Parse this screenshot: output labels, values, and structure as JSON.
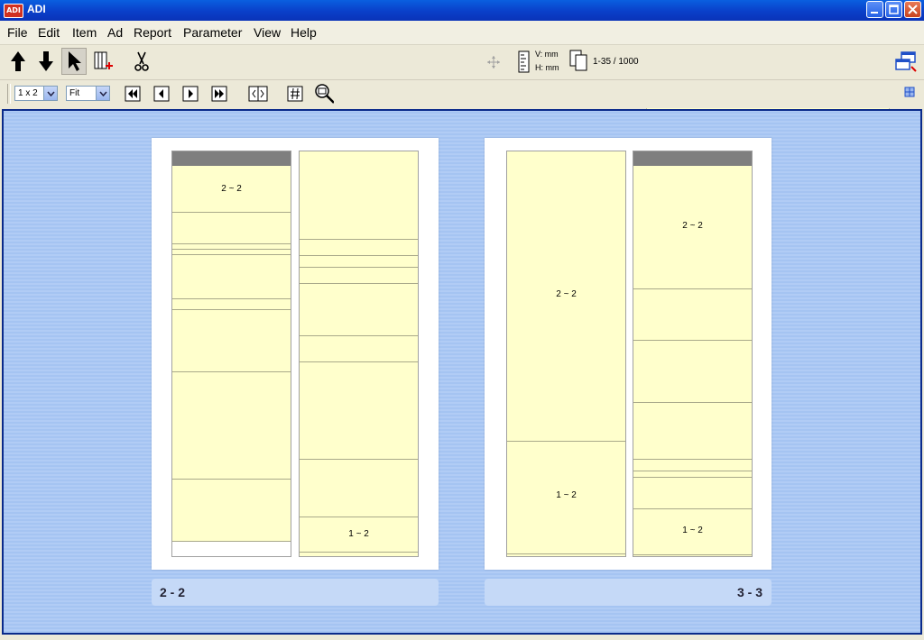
{
  "window": {
    "title": "ADI",
    "icon_label": "ADI"
  },
  "menu": [
    "File",
    "Edit",
    "Item",
    "Ad",
    "Report",
    "Parameter",
    "View",
    "Help"
  ],
  "toolbar": {
    "vertical_unit": "V: mm",
    "horizontal_unit": "H: mm",
    "page_range": "1-35 / 1000",
    "layout_combo": "1 x 2",
    "zoom_combo": "Fit"
  },
  "pages": [
    {
      "footer": "2 - 2",
      "left_column_labels": [
        "2 ~ 2"
      ],
      "right_column_labels": [
        "1 ~ 2"
      ]
    },
    {
      "footer": "3 - 3",
      "left_column_labels": [
        "2 ~ 2",
        "1 ~ 2"
      ],
      "right_column_labels": [
        "2 ~ 2",
        "1 ~ 2"
      ]
    }
  ],
  "colors": {
    "canvas": "#a9c7f3",
    "cell_fill": "#ffffcc",
    "header_bar": "#7f7f7f",
    "title_bar": "#0a4fd8"
  }
}
